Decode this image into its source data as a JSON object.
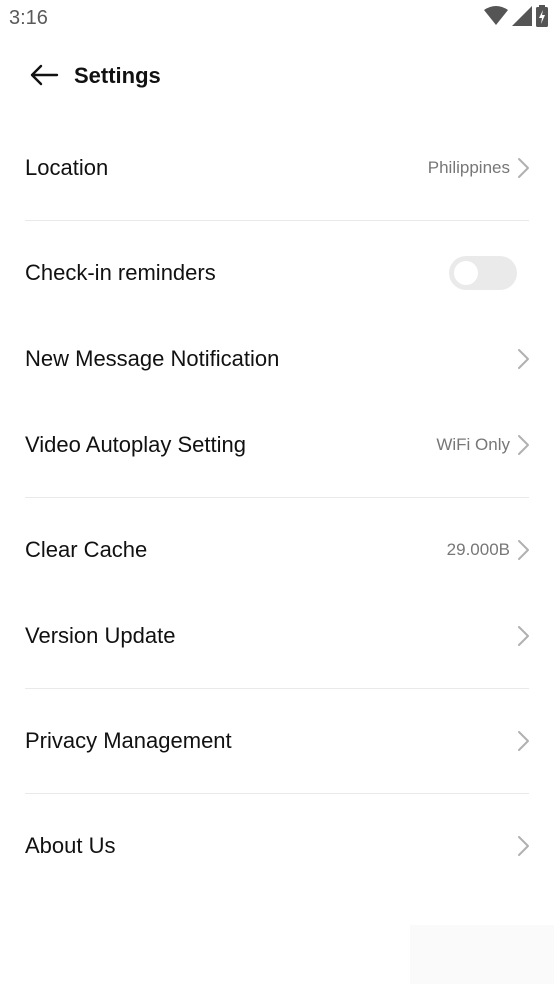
{
  "status_bar": {
    "time": "3:16",
    "icons": [
      "wifi-icon",
      "cellular-signal-icon",
      "battery-icon"
    ]
  },
  "header": {
    "back_icon": "arrow-left-icon",
    "title": "Settings"
  },
  "settings": {
    "location": {
      "label": "Location",
      "value": "Philippines"
    },
    "checkin": {
      "label": "Check-in reminders",
      "enabled": false
    },
    "new_message": {
      "label": "New Message Notification"
    },
    "video_autoplay": {
      "label": "Video Autoplay Setting",
      "value": "WiFi Only"
    },
    "clear_cache": {
      "label": "Clear Cache",
      "value": "29.000B"
    },
    "version_update": {
      "label": "Version Update"
    },
    "privacy": {
      "label": "Privacy Management"
    },
    "about": {
      "label": "About Us"
    }
  },
  "colors": {
    "text_primary": "#111111",
    "text_secondary": "#777777",
    "divider": "#e9e9e9",
    "toggle_off": "#eaeaea",
    "chevron": "#b0b0b0"
  }
}
